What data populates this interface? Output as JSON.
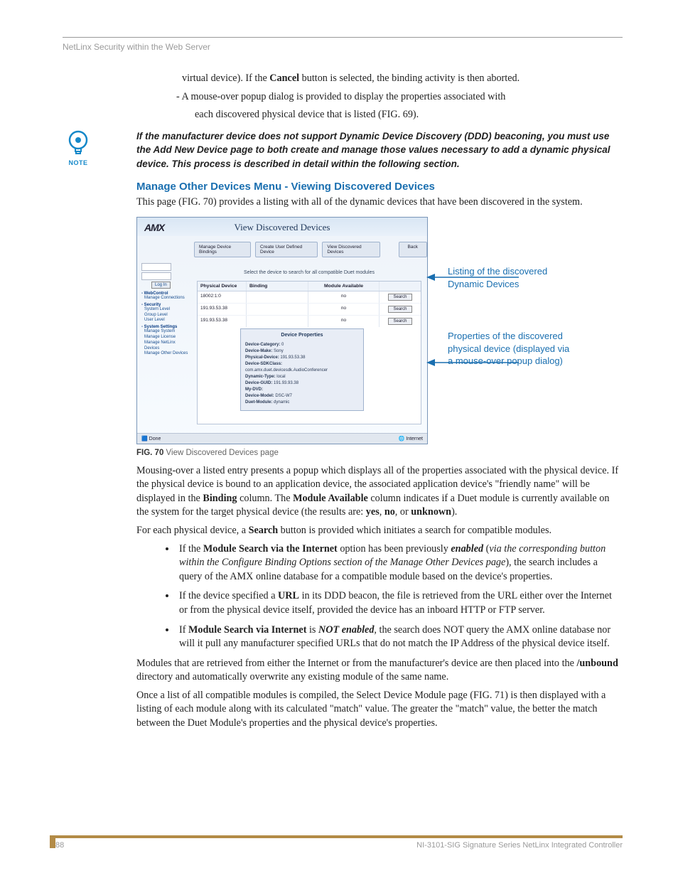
{
  "running_head": "NetLinx Security within the Web Server",
  "intro": {
    "line1_pre": "virtual device). If the ",
    "line1_bold": "Cancel",
    "line1_post": " button is selected, the binding activity is then aborted.",
    "line2a": "- A mouse-over popup dialog is provided to display the properties associated with",
    "line2b": "each discovered physical device that is listed (FIG. 69)."
  },
  "note": {
    "label": "NOTE",
    "text": "If the manufacturer device does not support Dynamic Device Discovery (DDD) beaconing, you must use the Add New Device page to both create and manage those values necessary to add a dynamic physical device. This process is described in detail within the following section."
  },
  "heading": "Manage Other Devices Menu - Viewing Discovered Devices",
  "heading_sub": "This page (FIG. 70) provides a listing with all of the dynamic devices that have been discovered in the system.",
  "screenshot": {
    "logo": "AMX",
    "title": "View Discovered Devices",
    "tabs": [
      "Manage Device Bindings",
      "Create User Defined Device",
      "View Discovered Devices"
    ],
    "back": "Back",
    "login_btn": "Log In",
    "side": {
      "webcontrol": "- WebControl",
      "webcontrol_items": [
        "Manage Connections"
      ],
      "security": "- Security",
      "security_items": [
        "System Level",
        "Group Level",
        "User Level"
      ],
      "system": "- System Settings",
      "system_items": [
        "Manage System",
        "Manage License",
        "Manage NetLinx Devices",
        "Manage Other Devices"
      ]
    },
    "instruction": "Select the device to search for all compatible Duet modules",
    "columns": [
      "Physical Device",
      "Binding",
      "Module Available",
      ""
    ],
    "rows": [
      {
        "dev": "18002:1:0",
        "bind": "",
        "mod": "no",
        "btn": "Search"
      },
      {
        "dev": "191.93.53.38",
        "bind": "",
        "mod": "no",
        "btn": "Search"
      },
      {
        "dev": "191.93.53.38",
        "bind": "",
        "mod": "no",
        "btn": "Search"
      }
    ],
    "popup": {
      "title": "Device Properties",
      "rows": [
        [
          "Device-Category:",
          "0"
        ],
        [
          "Device-Make:",
          "Sony"
        ],
        [
          "Physical-Device:",
          "191.93.53.38"
        ],
        [
          "Device-SDKClass:",
          "com.amx.duet.devicesdk.AudioConferencer"
        ],
        [
          "Dynamic-Type:",
          "local"
        ],
        [
          "Device-GUID:",
          "191.93.93.38"
        ],
        [
          "My-DVD:",
          ""
        ],
        [
          "Device-Model:",
          "DSC-W7"
        ],
        [
          "Duet-Module:",
          "dynamic"
        ]
      ]
    },
    "status_left": "Done",
    "status_right": "Internet"
  },
  "callout1": "Listing of the discovered Dynamic Devices",
  "callout2": "Properties of the discovered physical device (displayed via a mouse-over popup dialog)",
  "fig_caption_bold": "FIG. 70",
  "fig_caption_rest": "  View Discovered Devices page",
  "p_mouse": {
    "t1": "Mousing-over a listed entry presents a popup which displays all of the properties associated with the physical device. If the physical device is bound to an application device, the associated application device's \"friendly name\" will be displayed in the ",
    "b1": "Binding",
    "t2": " column. The ",
    "b2": "Module Available",
    "t3": " column indicates if a Duet module is currently available on the system for the target physical device (the results are: ",
    "b3": "yes",
    "t4": ", ",
    "b4": "no",
    "t5": ", or ",
    "b5": "unknown",
    "t6": ")."
  },
  "p_search": {
    "t1": "For each physical device, a ",
    "b1": "Search",
    "t2": " button is provided which initiates a search for compatible modules."
  },
  "bullets": {
    "b1": {
      "t1": "If the ",
      "bold1": "Module Search via the Internet",
      "t2": " option has been previously ",
      "ib1": "enabled",
      "t3": " (",
      "i1": "via the corresponding button within the Configure Binding Options section of the Manage Other Devices page",
      "t4": "), the search includes a query of the AMX online database for a compatible module based on the device's properties."
    },
    "b2": {
      "t1": "If the device specified a ",
      "bold1": "URL",
      "t2": " in its DDD beacon, the file is retrieved from the URL either over the Internet or from the physical device itself, provided the device has an inboard HTTP or FTP server."
    },
    "b3": {
      "t1": "If ",
      "bold1": "Module Search via Internet",
      "t2": " is ",
      "ib1": "NOT enabled",
      "t3": ", the search does NOT query the AMX online database nor will it pull any manufacturer specified URLs that do not match the IP Address of the physical device itself."
    }
  },
  "p_mods": {
    "t1": "Modules that are retrieved from either the Internet or from the manufacturer's device are then placed into the ",
    "b1": "/unbound",
    "t2": " directory and automatically overwrite any existing module of the same name."
  },
  "p_once": "Once a list of all compatible modules is compiled, the Select Device Module page (FIG. 71) is then displayed with a listing of each module along with its calculated \"match\" value. The greater the \"match\" value, the better the match between the Duet Module's properties and the physical device's properties.",
  "footer": {
    "page": "88",
    "doc": "NI-3101-SIG Signature Series NetLinx Integrated Controller"
  }
}
